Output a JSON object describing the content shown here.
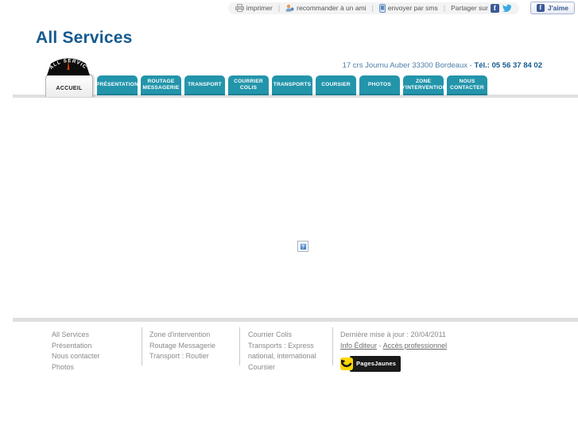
{
  "colors": {
    "teal": "#2395ab",
    "title_blue": "#155a8f",
    "facebook_blue": "#3b5998",
    "twitter_blue": "#3aaae1",
    "pagesjaunes_yellow": "#ffd503"
  },
  "toolbar": {
    "print_label": "imprimer",
    "recommend_label": "recommander à un ami",
    "sms_label": "envoyer par sms",
    "share_label": "Partager sur",
    "like_label": "J'aime",
    "separator": "|",
    "facebook_glyph": "f"
  },
  "header": {
    "title": "All Services",
    "address": "17 crs Journu Auber 33300 Bordeaux",
    "address_separator": "-",
    "phone": "Tél.: 05 56 37 84 02",
    "logo_text": "ALL SERVICES"
  },
  "nav": {
    "tabs": [
      {
        "line1": "ACCUEIL",
        "line2": ""
      },
      {
        "line1": "PRÉSENTATION",
        "line2": ""
      },
      {
        "line1": "ROUTAGE",
        "line2": "MESSAGERIE"
      },
      {
        "line1": "TRANSPORT",
        "line2": ""
      },
      {
        "line1": "COURRIER",
        "line2": "COLIS"
      },
      {
        "line1": "TRANSPORTS",
        "line2": ""
      },
      {
        "line1": "COURSIER",
        "line2": ""
      },
      {
        "line1": "PHOTOS",
        "line2": ""
      },
      {
        "line1": "ZONE",
        "line2": "D'INTERVENTION"
      },
      {
        "line1": "NOUS",
        "line2": "CONTACTER"
      }
    ]
  },
  "content": {
    "broken_image_glyph": "?"
  },
  "footer": {
    "col1": [
      "All Services",
      "Présentation",
      "Nous contacter",
      "Photos"
    ],
    "col2": [
      "Zone d'intervention",
      "Routage Messagerie",
      "Transport : Routier"
    ],
    "col3": [
      "Courrier Colis",
      "Transports : Express national, international",
      "Coursier"
    ],
    "col4": {
      "updated": "Dernière mise à jour : 20/04/2011",
      "editor_link": "Info Éditeur",
      "link_separator": "-",
      "pro_link": "Accès professionnel",
      "brand": "PagesJaunes"
    }
  }
}
